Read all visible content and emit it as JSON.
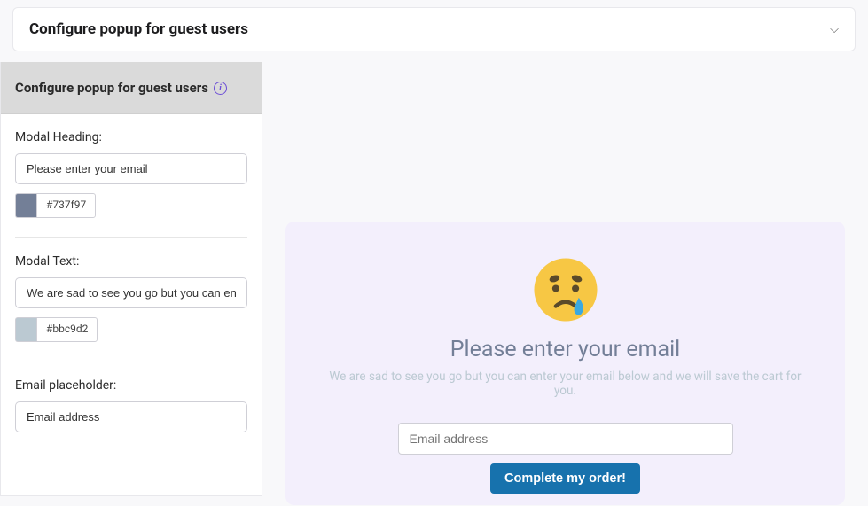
{
  "header": {
    "title": "Configure popup for guest users"
  },
  "sidebar": {
    "title": "Configure popup for guest users",
    "fields": {
      "modal_heading": {
        "label": "Modal Heading:",
        "value": "Please enter your email",
        "color_hex": "#737f97"
      },
      "modal_text": {
        "label": "Modal Text:",
        "value": "We are sad to see you go but you can enter your email below and we will save the cart for you.",
        "color_hex": "#bbc9d2"
      },
      "email_placeholder": {
        "label": "Email placeholder:",
        "value": "Email address"
      }
    }
  },
  "preview": {
    "heading": "Please enter your email",
    "heading_color": "#737f97",
    "text": "We are sad to see you go but you can enter your email below and we will save the cart for you.",
    "text_color": "#bbc9d2",
    "email_placeholder": "Email address",
    "button_label": "Complete my order!"
  }
}
